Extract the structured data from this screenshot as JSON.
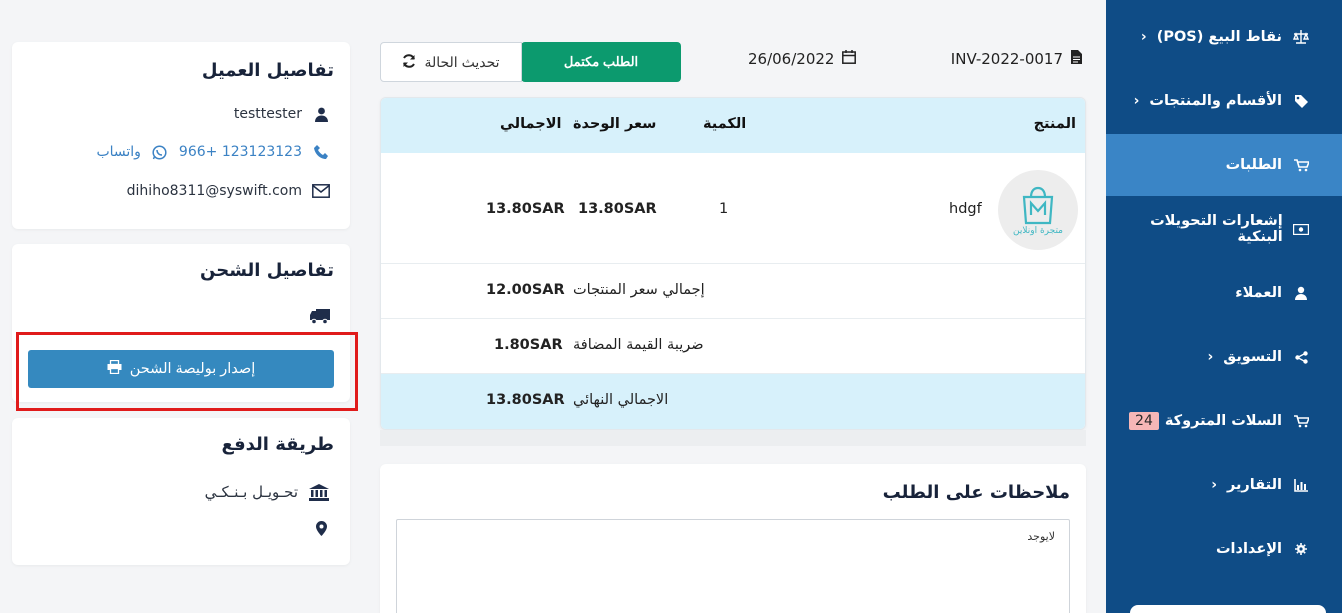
{
  "sidebar": {
    "items": [
      {
        "label": "نقاط البيع (POS)",
        "chevron": "‹",
        "icon": "scale-icon"
      },
      {
        "label": "الأقسام والمنتجات",
        "chevron": "‹",
        "icon": "tag-icon"
      },
      {
        "label": "الطلبات",
        "chevron": "",
        "icon": "cart-icon",
        "active": true
      },
      {
        "label": "إشعارات التحويلات البنكية",
        "chevron": "",
        "icon": "money-icon"
      },
      {
        "label": "العملاء",
        "chevron": "",
        "icon": "user-icon"
      },
      {
        "label": "التسويق",
        "chevron": "‹",
        "icon": "share-icon"
      },
      {
        "label": "السلات المتروكة",
        "chevron": "",
        "icon": "cart-icon",
        "badge": "24"
      },
      {
        "label": "التقارير",
        "chevron": "‹",
        "icon": "chart-icon"
      },
      {
        "label": "الإعدادات",
        "chevron": "",
        "icon": "gear-icon"
      }
    ]
  },
  "order": {
    "invoice": "INV-2022-0017",
    "date": "26/06/2022",
    "status_label": "الطلب مكتمل",
    "refresh_label": "تحديث الحالة"
  },
  "products": {
    "headers": {
      "product": "المنتج",
      "quantity": "الكمية",
      "unit_price": "سعر الوحدة",
      "total": "الاجمالي"
    },
    "rows": [
      {
        "name": "hdgf",
        "quantity": "1",
        "unit_price": "13.80SAR",
        "total": "13.80SAR"
      }
    ],
    "store_logo_text": "متجرة اونلاين",
    "summary": {
      "subtotal_label": "إجمالي سعر المنتجات",
      "subtotal_value": "12.00SAR",
      "vat_label": "ضريبة القيمة المضافة",
      "vat_value": "1.80SAR",
      "grand_label": "الاجمالي النهائي",
      "grand_value": "13.80SAR"
    }
  },
  "notes": {
    "title": "ملاحظات على الطلب",
    "value": "لايوجد"
  },
  "customer": {
    "title": "تفاصيل العميل",
    "name": "testtester",
    "phone": "966+ 123123123",
    "whatsapp_label": "واتساب",
    "email": "dihiho8311@syswift.com"
  },
  "shipping": {
    "title": "تفاصيل الشحن",
    "issue_label": "إصدار بوليصة الشحن"
  },
  "payment": {
    "title": "طريقة الدفع",
    "method": "تحـويـل بـنـكـي"
  },
  "colors": {
    "sidebar_bg": "#0f4c86",
    "sidebar_active": "#3a85c6",
    "status_green": "#0c9a6e",
    "table_header": "#d7f1fb",
    "ship_button": "#3589bf",
    "highlight": "#e01b1b"
  }
}
